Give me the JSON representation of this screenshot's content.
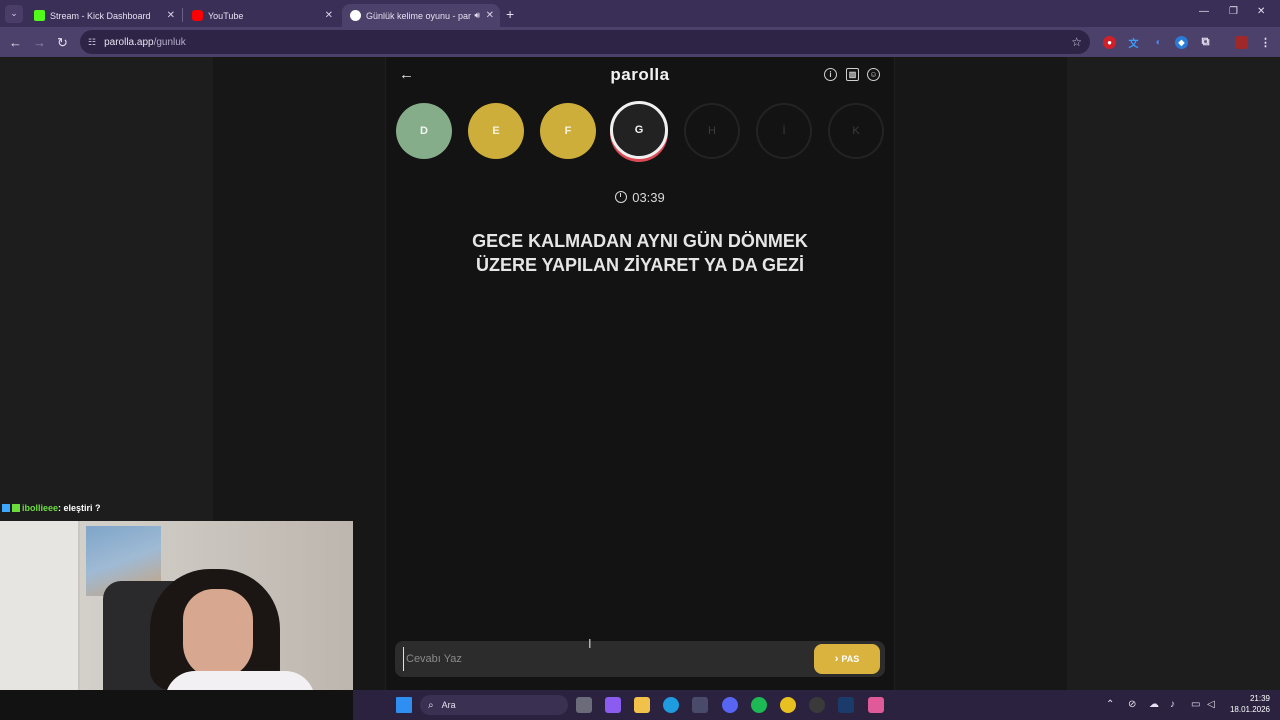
{
  "browser": {
    "tabs": [
      {
        "title": "Stream - Kick Dashboard",
        "favicon_color": "#53fc18"
      },
      {
        "title": "YouTube",
        "favicon_color": "#ff0000"
      },
      {
        "title": "Günlük kelime oyunu - par",
        "favicon_color": "#ffffff",
        "active": true
      }
    ],
    "url_host": "parolla.app",
    "url_path": "/gunluk"
  },
  "game": {
    "logo": "parolla",
    "letters": [
      {
        "char": "D",
        "state": "correct"
      },
      {
        "char": "E",
        "state": "passed"
      },
      {
        "char": "F",
        "state": "passed"
      },
      {
        "char": "G",
        "state": "current"
      },
      {
        "char": "H",
        "state": "pending"
      },
      {
        "char": "İ",
        "state": "pending"
      },
      {
        "char": "K",
        "state": "pending"
      }
    ],
    "timer": "03:39",
    "question_line1": "GECE KALMADAN AYNI GÜN DÖNMEK",
    "question_line2": "ÜZERE YAPILAN ZİYARET YA DA GEZİ",
    "answer_placeholder": "Cevabı Yaz",
    "pass_label": "PAS"
  },
  "chat": {
    "user": "ibollieee",
    "message": ": eleştiri ?"
  },
  "taskbar": {
    "search_label": "Ara",
    "time": "21:39",
    "date": "18.01.2026"
  },
  "colors": {
    "correct": "#85ad8a",
    "passed": "#cdae3a",
    "current_ring": "#d94a55",
    "pass_button": "#d9b33e"
  }
}
